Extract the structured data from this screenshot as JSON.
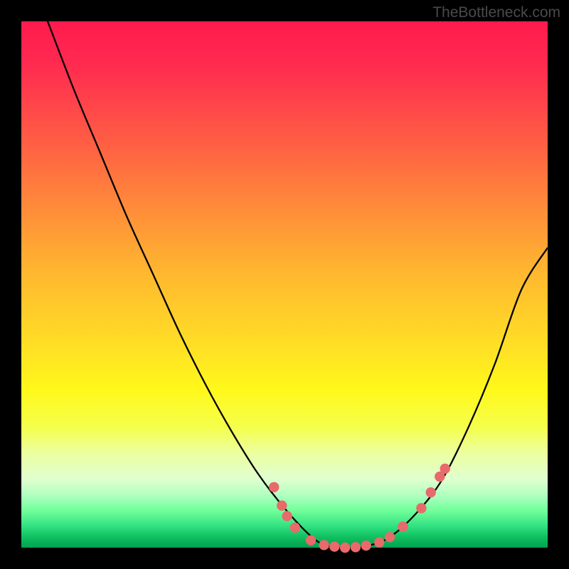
{
  "watermark": "TheBottleneck.com",
  "chart_data": {
    "type": "line",
    "title": "",
    "xlabel": "",
    "ylabel": "",
    "x_range": [
      0,
      100
    ],
    "y_range": [
      0,
      100
    ],
    "curve_points": [
      {
        "x": 5.0,
        "y": 100.0
      },
      {
        "x": 10.0,
        "y": 87.0
      },
      {
        "x": 15.0,
        "y": 75.0
      },
      {
        "x": 20.0,
        "y": 63.0
      },
      {
        "x": 25.0,
        "y": 52.0
      },
      {
        "x": 30.0,
        "y": 41.0
      },
      {
        "x": 35.0,
        "y": 31.0
      },
      {
        "x": 40.0,
        "y": 22.0
      },
      {
        "x": 45.0,
        "y": 14.0
      },
      {
        "x": 50.0,
        "y": 7.5
      },
      {
        "x": 55.0,
        "y": 2.2
      },
      {
        "x": 58.0,
        "y": 0.4
      },
      {
        "x": 62.0,
        "y": 0.0
      },
      {
        "x": 66.0,
        "y": 0.4
      },
      {
        "x": 70.0,
        "y": 2.0
      },
      {
        "x": 75.0,
        "y": 6.5
      },
      {
        "x": 80.0,
        "y": 13.0
      },
      {
        "x": 85.0,
        "y": 23.0
      },
      {
        "x": 90.0,
        "y": 35.0
      },
      {
        "x": 95.0,
        "y": 49.0
      },
      {
        "x": 100.0,
        "y": 57.0
      }
    ],
    "markers": [
      {
        "x": 48.0,
        "y": 11.5
      },
      {
        "x": 49.5,
        "y": 8.0
      },
      {
        "x": 50.5,
        "y": 6.0
      },
      {
        "x": 52.0,
        "y": 3.8
      },
      {
        "x": 55.0,
        "y": 1.4
      },
      {
        "x": 57.5,
        "y": 0.5
      },
      {
        "x": 59.5,
        "y": 0.2
      },
      {
        "x": 61.5,
        "y": 0.0
      },
      {
        "x": 63.5,
        "y": 0.1
      },
      {
        "x": 65.5,
        "y": 0.4
      },
      {
        "x": 68.0,
        "y": 1.0
      },
      {
        "x": 70.0,
        "y": 2.0
      },
      {
        "x": 72.5,
        "y": 4.0
      },
      {
        "x": 76.0,
        "y": 7.5
      },
      {
        "x": 77.8,
        "y": 10.5
      },
      {
        "x": 79.5,
        "y": 13.5
      },
      {
        "x": 80.5,
        "y": 15.0
      }
    ],
    "marker_radius": 7.2,
    "gradient_stops": [
      {
        "pos": 0.0,
        "color": "#ff1a4d"
      },
      {
        "pos": 0.22,
        "color": "#ff5a45"
      },
      {
        "pos": 0.48,
        "color": "#ffb82f"
      },
      {
        "pos": 0.7,
        "color": "#fff81a"
      },
      {
        "pos": 0.85,
        "color": "#e0ffd0"
      },
      {
        "pos": 0.93,
        "color": "#70ff9a"
      },
      {
        "pos": 1.0,
        "color": "#00a050"
      }
    ]
  }
}
